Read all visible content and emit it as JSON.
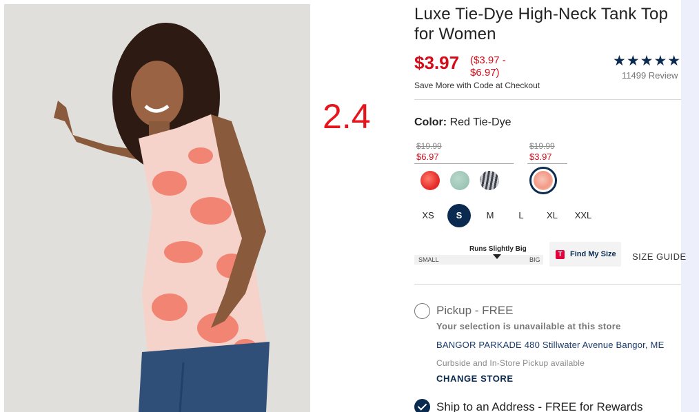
{
  "overlay": {
    "label": "2.4"
  },
  "product": {
    "title": "Luxe Tie-Dye High-Neck Tank Top for Women",
    "price": "$3.97",
    "price_range": "($3.97 - $6.97)",
    "promo_note": "Save More with Code at Checkout",
    "rating": {
      "stars": "★★★★★",
      "value": 5,
      "reviews_label": "11499 Review"
    }
  },
  "color": {
    "label": "Color:",
    "selected": "Red Tie-Dye",
    "price_groups": [
      {
        "original": "$19.99",
        "sale": "$6.97"
      },
      {
        "original": "$19.99",
        "sale": "$3.97"
      }
    ],
    "swatches": [
      {
        "name": "red-tie-dye-swatch",
        "color": "#ef3b33"
      },
      {
        "name": "sage-swatch",
        "color": "#9cc4b5"
      },
      {
        "name": "grey-stripe-swatch",
        "color": "#5a5e66"
      },
      {
        "name": "pink-tie-dye-swatch",
        "color": "#f4a99a",
        "selected": true
      }
    ]
  },
  "sizes": {
    "options": [
      "XS",
      "S",
      "M",
      "L",
      "XL",
      "XXL"
    ],
    "selected": "S"
  },
  "fit": {
    "label": "Runs Slightly Big",
    "low": "SMALL",
    "high": "BIG",
    "position": 0.64
  },
  "find_size": {
    "icon": "T",
    "label": "Find My Size"
  },
  "size_guide": "SIZE GUIDE",
  "pickup": {
    "label": "Pickup - FREE",
    "unavailable": "Your selection is unavailable at this store",
    "store": "BANGOR PARKADE 480 Stillwater Avenue  Bangor, ME",
    "note": "Curbside and In-Store Pickup available",
    "change_label": "CHANGE STORE"
  },
  "ship": {
    "label": "Ship to an Address - FREE for Rewards"
  },
  "colors": {
    "accent": "#0b2a4f",
    "sale": "#d50d1b"
  }
}
